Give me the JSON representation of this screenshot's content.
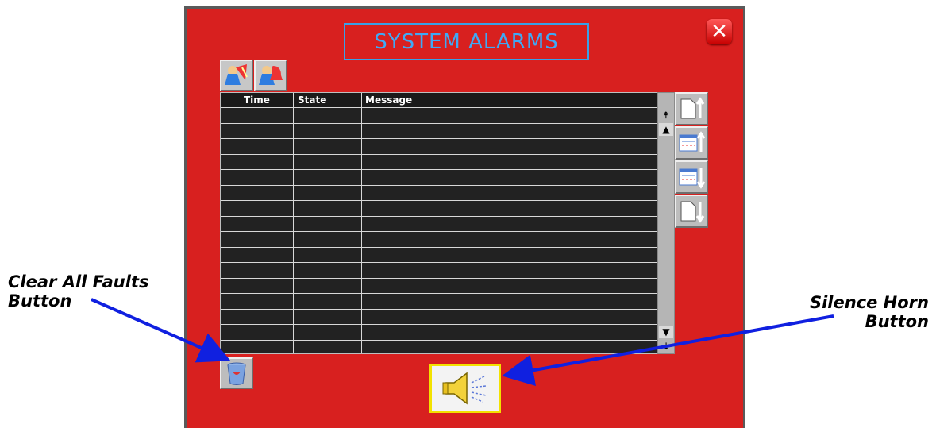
{
  "panel": {
    "title": "SYSTEM ALARMS",
    "background_color": "#d8201f",
    "title_color": "#3fa9f5"
  },
  "close_button": {
    "icon": "close-icon",
    "glyph": "✕"
  },
  "toolbar": {
    "buttons": [
      {
        "icon": "user-alarm-icon"
      },
      {
        "icon": "user-bell-icon"
      }
    ]
  },
  "alarm_table": {
    "columns": [
      "",
      "Time",
      "State",
      "Message"
    ],
    "row_count": 16,
    "rows": []
  },
  "scrollbar": {
    "top_glyph": "⯭",
    "up_glyph": "▲",
    "down_glyph": "▼",
    "bottom_glyph": "⯯"
  },
  "side_buttons": [
    {
      "icon": "page-up-icon"
    },
    {
      "icon": "list-up-icon"
    },
    {
      "icon": "list-down-icon"
    },
    {
      "icon": "page-down-icon"
    }
  ],
  "bottom_buttons": {
    "clear_icon": "trash-icon",
    "silence_icon": "speaker-icon"
  },
  "callouts": {
    "clear_all_line1": "Clear All Faults",
    "clear_all_line2": "Button",
    "silence_line1": "Silence Horn",
    "silence_line2": "Button",
    "arrow_color": "#1020e0"
  }
}
